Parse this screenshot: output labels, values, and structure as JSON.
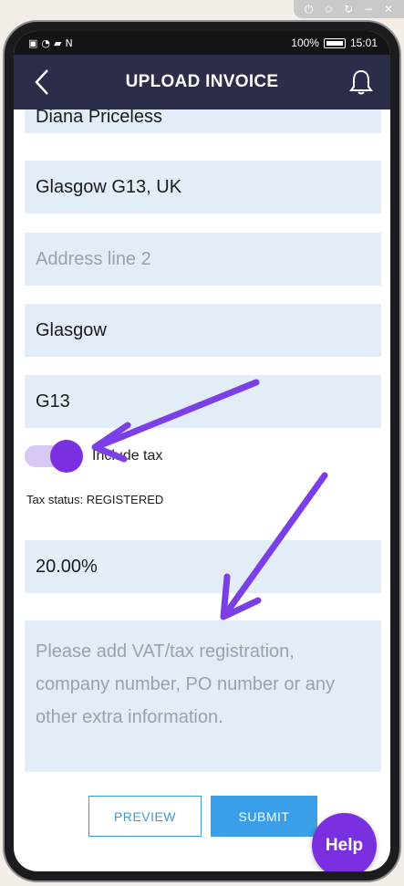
{
  "emulator": {
    "icons": [
      "power-icon",
      "pin-icon",
      "rotate-icon",
      "minimize-icon",
      "close-icon"
    ]
  },
  "status_bar": {
    "battery": "100%",
    "time": "15:01"
  },
  "header": {
    "title": "UPLOAD INVOICE"
  },
  "form": {
    "name_value": "Diana Priceless",
    "address_line_1": "Glasgow G13, UK",
    "address_line_2_placeholder": "Address line 2",
    "city": "Glasgow",
    "postcode": "G13",
    "include_tax_label": "Include tax",
    "include_tax_on": true,
    "tax_status": "Tax status: REGISTERED",
    "tax_rate": "20.00%",
    "notes_placeholder": "Please add VAT/tax registration, company number, PO number or any other extra information."
  },
  "actions": {
    "preview": "PREVIEW",
    "submit": "SUBMIT",
    "help": "Help"
  },
  "colors": {
    "header_bg": "#2b2d4a",
    "field_bg": "#e2edf8",
    "accent_purple": "#7a30e0",
    "button_blue": "#3a9ee8",
    "annotation_arrow": "#7b3fe8"
  }
}
